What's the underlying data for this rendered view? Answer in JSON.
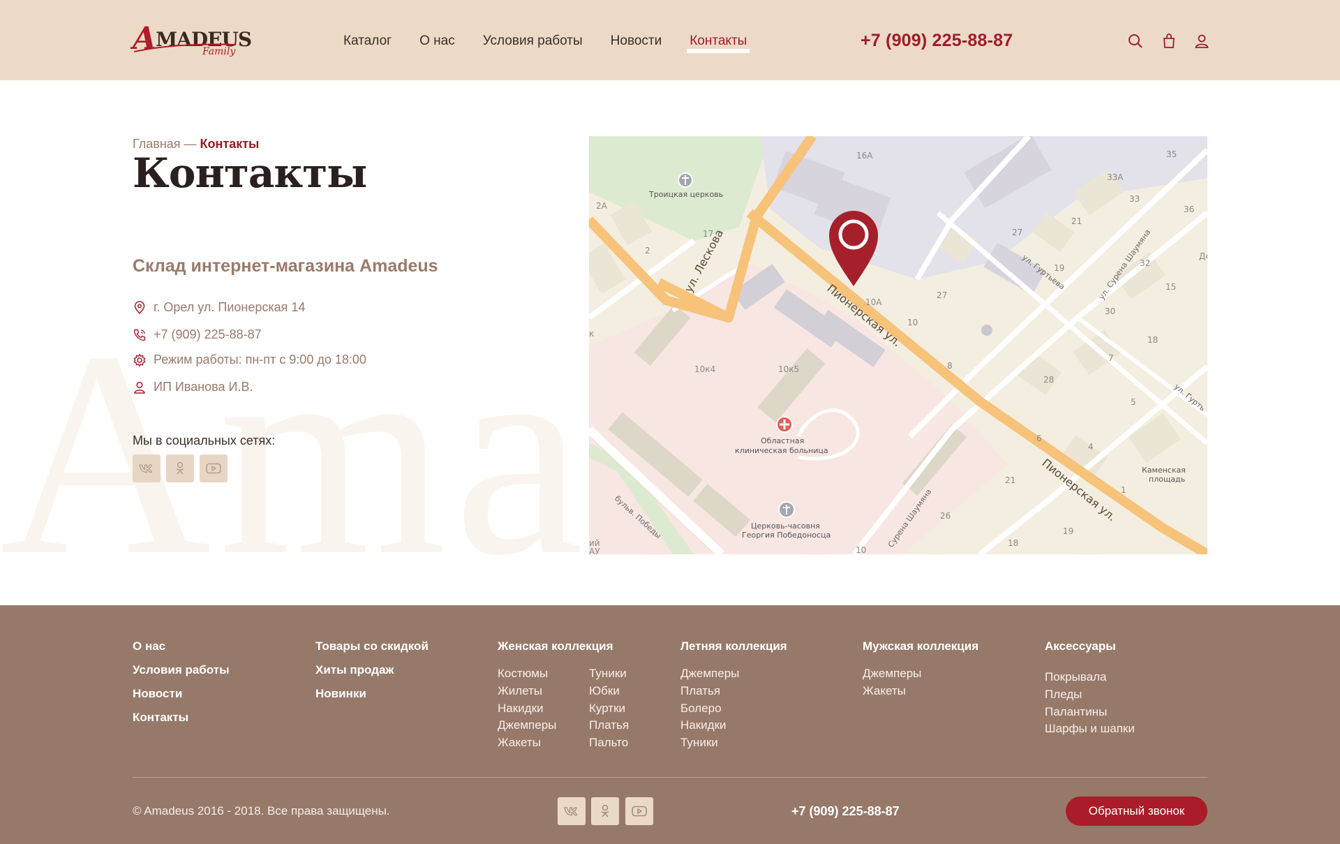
{
  "header": {
    "logo_main": "MADEUS",
    "logo_letter": "A",
    "logo_sub": "Family",
    "nav": [
      {
        "label": "Каталог"
      },
      {
        "label": "О нас"
      },
      {
        "label": "Условия работы"
      },
      {
        "label": "Новости"
      },
      {
        "label": "Контакты",
        "active": true
      }
    ],
    "phone": "+7 (909) 225-88-87",
    "icons": [
      "search-icon",
      "cart-icon",
      "user-icon"
    ]
  },
  "breadcrumb": {
    "home": "Главная",
    "separator": " — ",
    "current": "Контакты"
  },
  "page_title": "Контакты",
  "watermark": "Amadeus",
  "store": {
    "title": "Склад интернет-магазина Amadeus",
    "address": "г. Орел ул. Пионерская 14",
    "phone": "+7 (909) 225-88-87",
    "hours": "Режим работы: пн-пт с 9:00 до 18:00",
    "owner": "ИП Иванова И.В."
  },
  "social": {
    "label": "Мы в социальных сетях:",
    "networks": [
      "vk-icon",
      "odnoklassniki-icon",
      "youtube-icon"
    ]
  },
  "map": {
    "streets": [
      "ул. Лескова",
      "Пионерская ул.",
      "Пионерская ул.",
      "ул. Гуртьева",
      "ул. Сурена Шаумяна",
      "бульв. Победы",
      "Сурена Шаумяна",
      "ул. Гурть"
    ],
    "places": [
      "Троицкая церковь",
      "Областная",
      "клиническая больница",
      "Церковь-часовня",
      "Георгия Победоносца",
      "Каменская",
      "площадь"
    ],
    "numbers": [
      "16А",
      "35",
      "2А",
      "33А",
      "33",
      "36",
      "17",
      "27",
      "21",
      "2",
      "19",
      "32",
      "10А",
      "27",
      "15",
      "10",
      "30",
      "18",
      "10к4",
      "10к5",
      "8",
      "7",
      "28",
      "5",
      "6",
      "4",
      "21",
      "1",
      "26",
      "19",
      "18",
      "10",
      "Де",
      "к",
      "ий",
      "АУ"
    ],
    "colors": {
      "pin": "#a5202b",
      "road": "#f7c27a",
      "ground": "#f4eee0",
      "hospital": "#f8e6e3",
      "industrial": "#e3e1ea",
      "park": "#dcead0",
      "building": "#ddd7c7"
    }
  },
  "footer": {
    "col1": [
      "О нас",
      "Условия работы",
      "Новости",
      "Контакты"
    ],
    "col2": [
      "Товары со скидкой",
      "Хиты продаж",
      "Новинки"
    ],
    "women": {
      "title": "Женская коллекция",
      "left": [
        "Костюмы",
        "Жилеты",
        "Накидки",
        "Джемперы",
        "Жакеты"
      ],
      "right": [
        "Туники",
        "Юбки",
        "Куртки",
        "Платья",
        "Пальто"
      ]
    },
    "summer": {
      "title": "Летняя коллекция",
      "items": [
        "Джемперы",
        "Платья",
        "Болеро",
        "Накидки",
        "Туники"
      ]
    },
    "men": {
      "title": "Мужская коллекция",
      "items": [
        "Джемперы",
        "Жакеты"
      ]
    },
    "accessories": {
      "title": "Аксессуары",
      "items": [
        "Покрывала",
        "Пледы",
        "Палантины",
        "Шарфы и шапки"
      ]
    },
    "copyright": "© Amadeus 2016 - 2018. Все права защищены.",
    "phone": "+7 (909) 225-88-87",
    "callback": "Обратный звонок"
  }
}
